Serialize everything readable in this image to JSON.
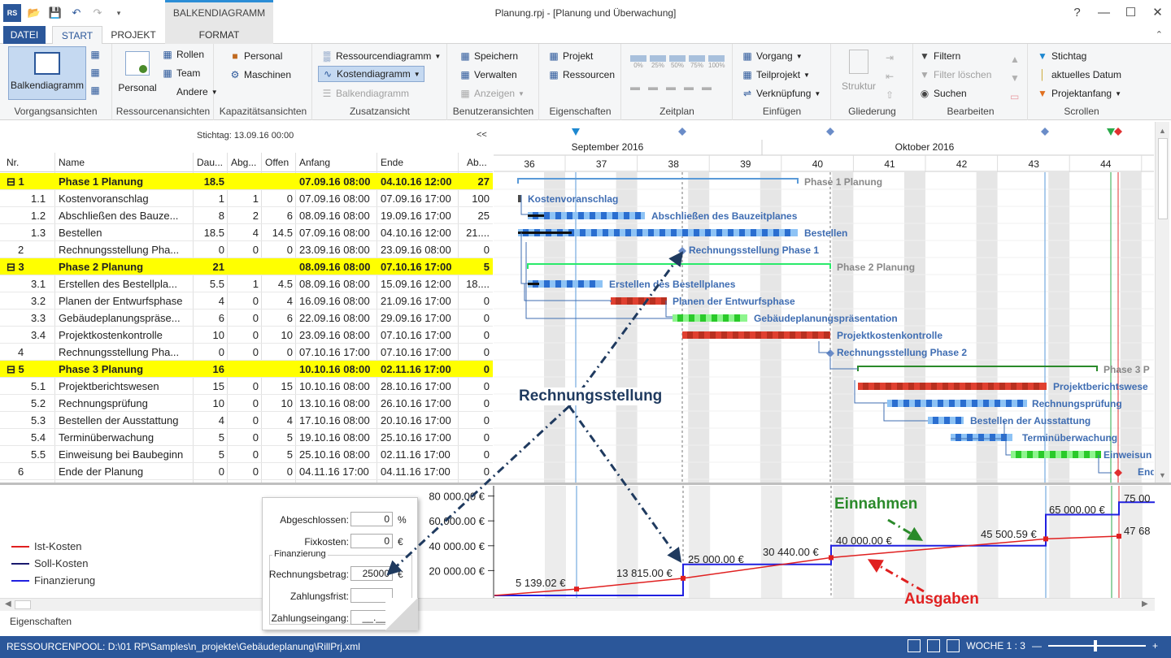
{
  "app": {
    "logo_text": "RS",
    "window_title": "Planung.rpj - [Planung und Überwachung]",
    "context_tab_header": "BALKENDIAGRAMM"
  },
  "tabs": [
    "DATEI",
    "START",
    "PROJEKT",
    "FORMAT"
  ],
  "ribbon": {
    "vorgangsansichten": {
      "big": "Balkendiagramm",
      "label": "Vorgangsansichten"
    },
    "ressourcenansichten": {
      "big": "Personal",
      "items": [
        "Rollen",
        "Team",
        "Andere"
      ],
      "label": "Ressourcenansichten"
    },
    "kapazitaet": {
      "items": [
        "Personal",
        "Maschinen"
      ],
      "label": "Kapazitätsansichten"
    },
    "zusatz": {
      "items": [
        "Ressourcendiagramm",
        "Kostendiagramm",
        "Balkendiagramm"
      ],
      "label": "Zusatzansicht"
    },
    "benutzer": {
      "items": [
        "Speichern",
        "Verwalten",
        "Anzeigen"
      ],
      "label": "Benutzeransichten"
    },
    "eigenschaften": {
      "items": [
        "Projekt",
        "Ressourcen"
      ],
      "label": "Eigenschaften"
    },
    "zeitplan": {
      "items": [
        "0%",
        "25%",
        "50%",
        "75%",
        "100%"
      ],
      "label": "Zeitplan"
    },
    "einfuegen": {
      "items": [
        "Vorgang",
        "Teilprojekt",
        "Verknüpfung"
      ],
      "label": "Einfügen"
    },
    "gliederung": {
      "big": "Struktur",
      "label": "Gliederung"
    },
    "bearbeiten": {
      "items": [
        "Filtern",
        "Filter löschen",
        "Suchen"
      ],
      "label": "Bearbeiten"
    },
    "scrollen": {
      "items": [
        "Stichtag",
        "aktuelles Datum",
        "Projektanfang"
      ],
      "label": "Scrollen"
    }
  },
  "table": {
    "status_date": "Stichtag: 13.09.16 00:00",
    "collapse": "<<",
    "columns": [
      "Nr.",
      "Name",
      "Dau...",
      "Abg...",
      "Offen",
      "Anfang",
      "Ende",
      "Ab..."
    ],
    "rows": [
      {
        "nr": "1",
        "name": "Phase 1 Planung",
        "dau": "18.5",
        "abg": "",
        "offen": "",
        "anfang": "07.09.16 08:00",
        "ende": "04.10.16 12:00",
        "ab": "27",
        "phase": true
      },
      {
        "nr": "1.1",
        "name": "Kostenvoranschlag",
        "dau": "1",
        "abg": "1",
        "offen": "0",
        "anfang": "07.09.16 08:00",
        "ende": "07.09.16 17:00",
        "ab": "100",
        "phase": false
      },
      {
        "nr": "1.2",
        "name": "Abschließen des Bauze...",
        "dau": "8",
        "abg": "2",
        "offen": "6",
        "anfang": "08.09.16 08:00",
        "ende": "19.09.16 17:00",
        "ab": "25",
        "phase": false
      },
      {
        "nr": "1.3",
        "name": "Bestellen",
        "dau": "18.5",
        "abg": "4",
        "offen": "14.5",
        "anfang": "07.09.16 08:00",
        "ende": "04.10.16 12:00",
        "ab": "21....",
        "phase": false
      },
      {
        "nr": "2",
        "name": "Rechnungsstellung Pha...",
        "dau": "0",
        "abg": "0",
        "offen": "0",
        "anfang": "23.09.16 08:00",
        "ende": "23.09.16 08:00",
        "ab": "0",
        "phase": false
      },
      {
        "nr": "3",
        "name": "Phase 2 Planung",
        "dau": "21",
        "abg": "",
        "offen": "",
        "anfang": "08.09.16 08:00",
        "ende": "07.10.16 17:00",
        "ab": "5",
        "phase": true
      },
      {
        "nr": "3.1",
        "name": "Erstellen des Bestellpla...",
        "dau": "5.5",
        "abg": "1",
        "offen": "4.5",
        "anfang": "08.09.16 08:00",
        "ende": "15.09.16 12:00",
        "ab": "18....",
        "phase": false
      },
      {
        "nr": "3.2",
        "name": "Planen der Entwurfsphase",
        "dau": "4",
        "abg": "0",
        "offen": "4",
        "anfang": "16.09.16 08:00",
        "ende": "21.09.16 17:00",
        "ab": "0",
        "phase": false
      },
      {
        "nr": "3.3",
        "name": "Gebäudeplanungspräse...",
        "dau": "6",
        "abg": "0",
        "offen": "6",
        "anfang": "22.09.16 08:00",
        "ende": "29.09.16 17:00",
        "ab": "0",
        "phase": false
      },
      {
        "nr": "3.4",
        "name": "Projektkostenkontrolle",
        "dau": "10",
        "abg": "0",
        "offen": "10",
        "anfang": "23.09.16 08:00",
        "ende": "07.10.16 17:00",
        "ab": "0",
        "phase": false
      },
      {
        "nr": "4",
        "name": "Rechnungsstellung Pha...",
        "dau": "0",
        "abg": "0",
        "offen": "0",
        "anfang": "07.10.16 17:00",
        "ende": "07.10.16 17:00",
        "ab": "0",
        "phase": false
      },
      {
        "nr": "5",
        "name": "Phase 3 Planung",
        "dau": "16",
        "abg": "",
        "offen": "",
        "anfang": "10.10.16 08:00",
        "ende": "02.11.16 17:00",
        "ab": "0",
        "phase": true
      },
      {
        "nr": "5.1",
        "name": "Projektberichtswesen",
        "dau": "15",
        "abg": "0",
        "offen": "15",
        "anfang": "10.10.16 08:00",
        "ende": "28.10.16 17:00",
        "ab": "0",
        "phase": false
      },
      {
        "nr": "5.2",
        "name": "Rechnungsprüfung",
        "dau": "10",
        "abg": "0",
        "offen": "10",
        "anfang": "13.10.16 08:00",
        "ende": "26.10.16 17:00",
        "ab": "0",
        "phase": false
      },
      {
        "nr": "5.3",
        "name": "Bestellen der Ausstattung",
        "dau": "4",
        "abg": "0",
        "offen": "4",
        "anfang": "17.10.16 08:00",
        "ende": "20.10.16 17:00",
        "ab": "0",
        "phase": false
      },
      {
        "nr": "5.4",
        "name": "Terminüberwachung",
        "dau": "5",
        "abg": "0",
        "offen": "5",
        "anfang": "19.10.16 08:00",
        "ende": "25.10.16 17:00",
        "ab": "0",
        "phase": false
      },
      {
        "nr": "5.5",
        "name": "Einweisung bei Baubeginn",
        "dau": "5",
        "abg": "0",
        "offen": "5",
        "anfang": "25.10.16 08:00",
        "ende": "02.11.16 17:00",
        "ab": "0",
        "phase": false
      },
      {
        "nr": "6",
        "name": "Ende der Planung",
        "dau": "0",
        "abg": "0",
        "offen": "0",
        "anfang": "04.11.16 17:00",
        "ende": "04.11.16 17:00",
        "ab": "0",
        "phase": false
      }
    ]
  },
  "gantt": {
    "months": [
      "September 2016",
      "Oktober 2016"
    ],
    "weeks": [
      "36",
      "37",
      "38",
      "39",
      "40",
      "41",
      "42",
      "43",
      "44"
    ],
    "bar_labels": [
      "Phase 1 Planung",
      "Kostenvoranschlag",
      "Abschließen des Bauzeitplanes",
      "Bestellen",
      "Rechnungsstellung Phase 1",
      "Phase 2 Planung",
      "Erstellen des Bestellplanes",
      "Planen der Entwurfsphase",
      "Gebäudeplanungspräsentation",
      "Projektkostenkontrolle",
      "Rechnungsstellung Phase 2",
      "Phase 3 P",
      "Projektberichtswese",
      "Rechnungsprüfung",
      "Bestellen der Ausstattung",
      "Terminüberwachung",
      "Einweisun",
      "Ende d"
    ]
  },
  "legend": [
    {
      "label": "Ist-Kosten",
      "color": "#e02020"
    },
    {
      "label": "Soll-Kosten",
      "color": "#1a1a6e"
    },
    {
      "label": "Finanzierung",
      "color": "#2020e0"
    }
  ],
  "chart_data": {
    "type": "line",
    "y_ticks": [
      "80 000.00 €",
      "60 000.00 €",
      "40 000.00 €",
      "20 000.00 €"
    ],
    "ylim": [
      0,
      80000
    ],
    "value_labels": [
      "5 139.02 €",
      "13 815.00 €",
      "25 000.00 €",
      "30 440.00 €",
      "40 000.00 €",
      "45 500.59 €",
      "65 000.00 €",
      "47 68",
      "75 00"
    ],
    "series": [
      {
        "name": "Ist-Kosten",
        "values": [
          0,
          5139.02,
          13815,
          30440,
          45500.59,
          47680
        ]
      },
      {
        "name": "Finanzierung",
        "values": [
          0,
          25000,
          40000,
          65000,
          75000
        ]
      }
    ]
  },
  "finance_popup": {
    "abgeschlossen_label": "Abgeschlossen:",
    "abgeschlossen_value": "0",
    "abgeschlossen_unit": "%",
    "fixkosten_label": "Fixkosten:",
    "fixkosten_value": "0",
    "fixkosten_unit": "€",
    "section": "Finanzierung",
    "betrag_label": "Rechnungsbetrag:",
    "betrag_value": "25000",
    "betrag_unit": "€",
    "frist_label": "Zahlungsfrist:",
    "eingang_label": "Zahlungseingang:",
    "eingang_value": "__.__."
  },
  "annotations": {
    "rechnung": "Rechnungsstellung",
    "einnahmen": "Einnahmen",
    "ausgaben": "Ausgaben"
  },
  "properties_tab": "Eigenschaften",
  "statusbar": {
    "path": "RESSOURCENPOOL: D:\\01 RP\\Samples\\n_projekte\\Gebäudeplanung\\RillPrj.xml",
    "zoom": "WOCHE 1 : 3"
  }
}
